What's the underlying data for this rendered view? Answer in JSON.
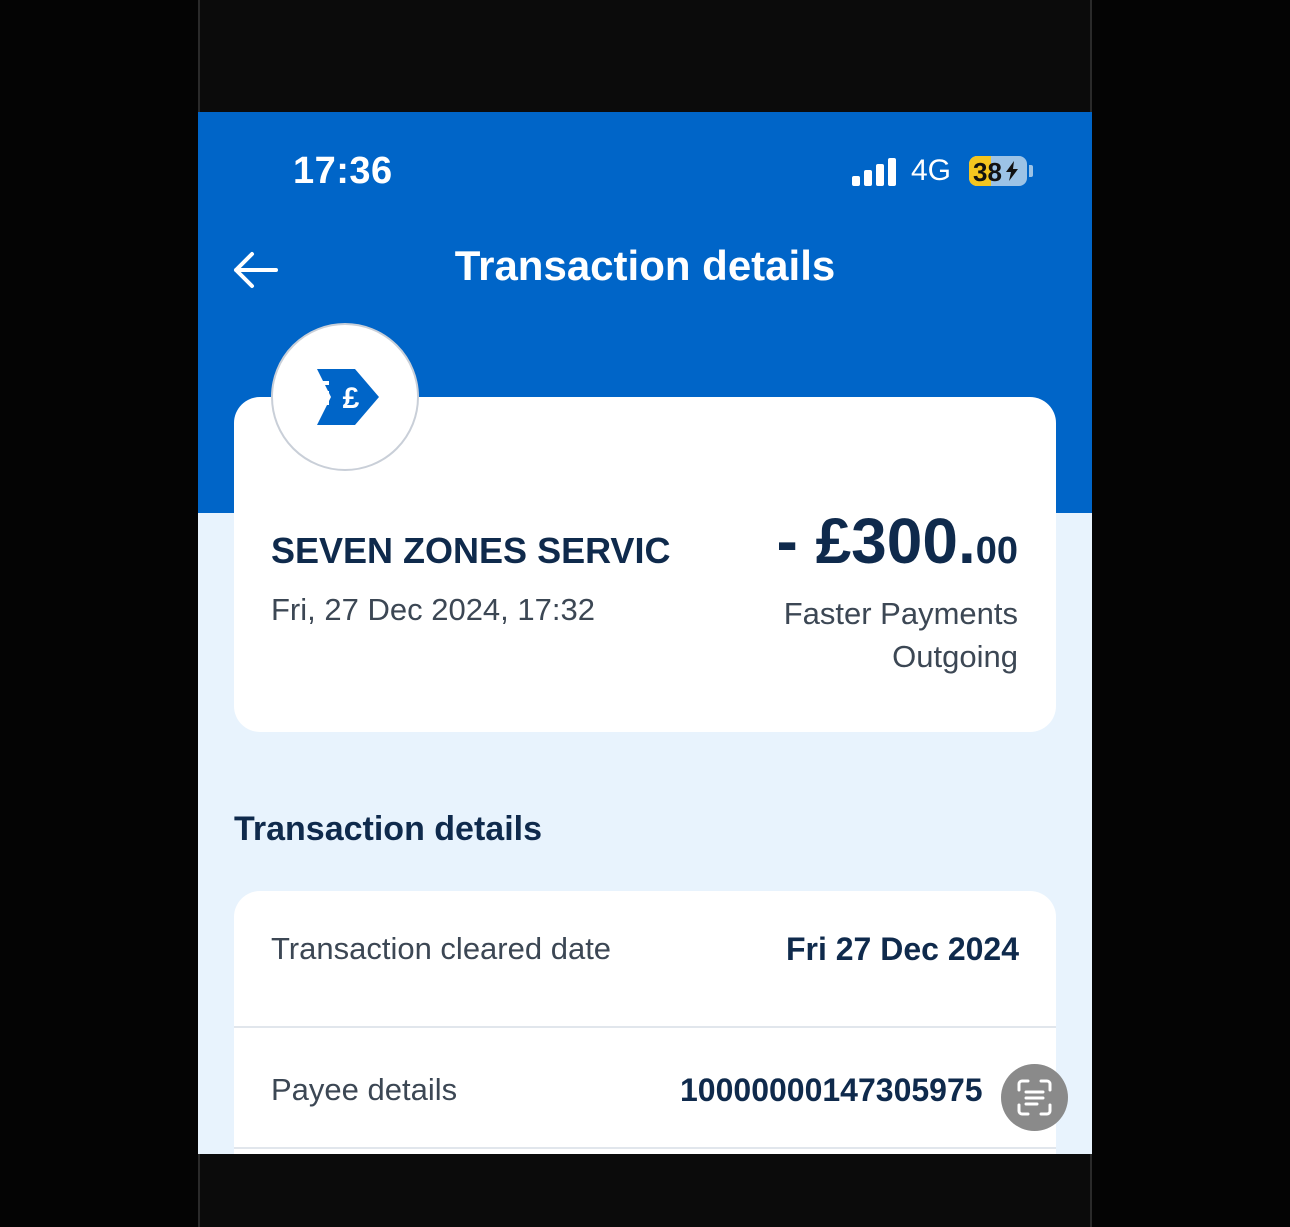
{
  "status_bar": {
    "time": "17:36",
    "network": "4G",
    "battery": "38",
    "battery_level_percent": 38
  },
  "header": {
    "title": "Transaction details",
    "back_icon": "arrow-left-icon"
  },
  "summary": {
    "icon": "faster-payment-pound-icon",
    "merchant": "SEVEN ZONES SERVIC",
    "datetime": "Fri, 27 Dec 2024, 17:32",
    "amount_main": "- £300.",
    "amount_decimal": "00",
    "payment_type_line1": "Faster Payments",
    "payment_type_line2": "Outgoing"
  },
  "details": {
    "section_title": "Transaction details",
    "rows": [
      {
        "label": "Transaction cleared date",
        "value": "Fri 27 Dec 2024"
      },
      {
        "label": "Payee details",
        "value": "10000000147305975"
      }
    ]
  },
  "overlay": {
    "scan_icon": "text-scan-icon"
  },
  "colors": {
    "header_blue": "#0065c8",
    "background_light": "#e8f3fd",
    "text_dark": "#0f2a4c",
    "battery_yellow": "#f4c51f"
  }
}
